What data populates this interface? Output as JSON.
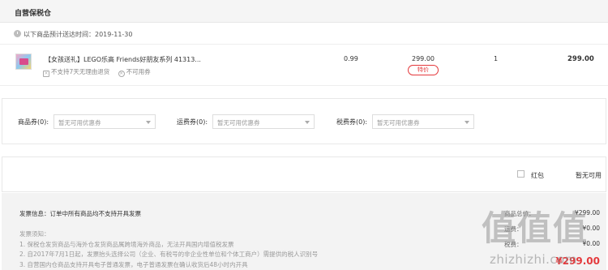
{
  "warehouse": {
    "title": "自营保税仓"
  },
  "delivery": {
    "text": "以下商品预计送达时间：2019-11-30"
  },
  "item": {
    "name": "【女孩送礼】LEGO乐高 Friends好朋友系列 41313...",
    "tags": [
      "不支持7天无理由退货",
      "不可用券"
    ],
    "weight": "0.99",
    "price": "299.00",
    "promo_badge": "特价",
    "quantity": "1",
    "subtotal": "299.00"
  },
  "coupons": [
    {
      "label": "商品券(0):",
      "value": "暂无可用优惠券"
    },
    {
      "label": "运费券(0):",
      "value": "暂无可用优惠券"
    },
    {
      "label": "税费券(0):",
      "value": "暂无可用优惠券"
    }
  ],
  "red_packet": {
    "label": "红包",
    "status": "暂无可用"
  },
  "invoice": {
    "title": "发票信息：订单中所有商品均不支持开具发票",
    "notes": [
      "发票须知：",
      "1. 保税仓发货商品与海外仓发货商品属跨境海外商品，无法开具国内增值税发票",
      "2. 自2017年7月1日起，发票抬头选择公司（企业、有税号的非企业性单位和个体工商户）需提供的税人识别号",
      "3. 自营国内仓商品支持开具电子普通发票，电子普通发票在确认收货后48小时内开具"
    ]
  },
  "summary": {
    "rows": [
      {
        "label": "商品总价：",
        "value": "¥299.00"
      },
      {
        "label": "运费：",
        "value": "¥0.00"
      },
      {
        "label": "税费：",
        "value": "¥0.00"
      }
    ],
    "total_value": "¥299.00"
  },
  "watermark": {
    "big": "值值值",
    "small": "zhizhizhi.com"
  },
  "colors": {
    "accent": "#e4393c",
    "header_bg": "#f5f5f5",
    "bottom_bg": "#f3f3f3"
  },
  "icons": {
    "clock": "clock-icon",
    "no_return": "no-return-icon",
    "no_coupon": "no-coupon-icon"
  }
}
